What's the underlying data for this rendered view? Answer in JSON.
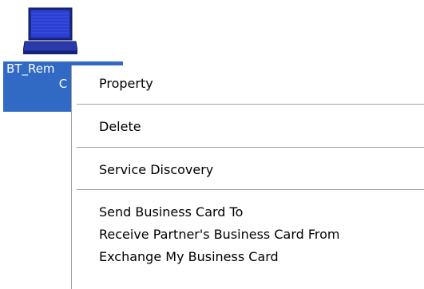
{
  "device": {
    "icon": "laptop-icon",
    "label_line1": "BT_Rem",
    "label_line2": "C",
    "selection_color": "#316ac5"
  },
  "context_menu": {
    "items": [
      {
        "label": "Property"
      },
      {
        "label": "Delete"
      },
      {
        "label": "Service Discovery"
      },
      {
        "label": "Send Business Card To"
      },
      {
        "label": "Receive Partner's Business Card From"
      },
      {
        "label": "Exchange My Business Card"
      }
    ]
  }
}
